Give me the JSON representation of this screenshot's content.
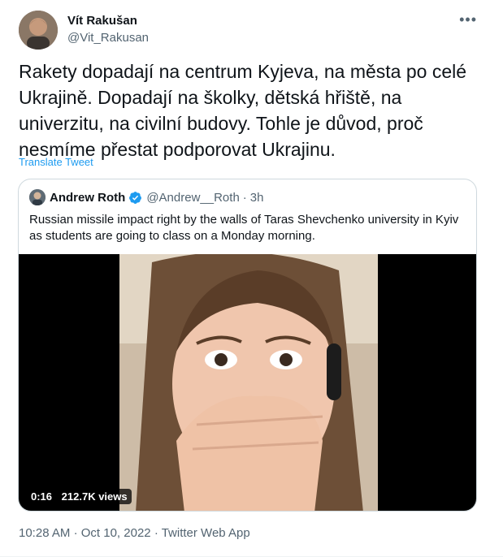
{
  "tweet": {
    "author_name": "Vít Rakušan",
    "author_handle": "@Vit_Rakusan",
    "more_label": "•••",
    "text": "Rakety dopadají na centrum Kyjeva, na města po celé Ukrajině. Dopadají na školky, dětská hřiště, na univerzitu, na civilní budovy. Tohle je důvod, proč nesmíme přestat podporovat Ukrajinu.",
    "translate_label": "Translate Tweet",
    "time": "10:28 AM",
    "date": "Oct 10, 2022",
    "source": "Twitter Web App",
    "sep": "·"
  },
  "quote": {
    "author_name": "Andrew Roth",
    "author_handle": "@Andrew__Roth",
    "sep": "·",
    "time_ago": "3h",
    "text": "Russian missile impact right by the walls of Taras Shevchenko university in Kyiv as students are going to class on a Monday morning.",
    "video": {
      "duration": "0:16",
      "views": "212.7K views"
    }
  },
  "icons": {
    "more": "more-icon",
    "verified": "verified-badge-icon"
  },
  "colors": {
    "link": "#1d9bf0",
    "secondary_text": "#536471",
    "border": "#cfd9de"
  }
}
